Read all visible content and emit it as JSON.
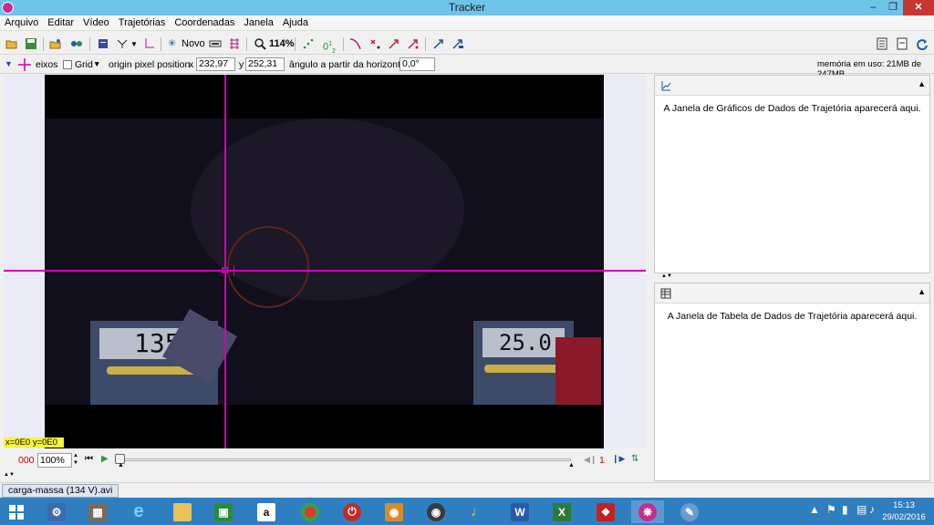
{
  "window": {
    "title": "Tracker"
  },
  "menu": [
    "Arquivo",
    "Editar",
    "Vídeo",
    "Trajetórias",
    "Coordenadas",
    "Janela",
    "Ajuda"
  ],
  "toolbar": {
    "new_label": "Novo",
    "zoom_label": "114%",
    "step_label": "0",
    "step_sub": "1",
    "step_sub2": "2"
  },
  "coords": {
    "axes_label": "eixos",
    "grid_label": "Grid",
    "origin_label": "origin pixel position",
    "x_label": "x",
    "x_value": "232,97",
    "y_label": "y",
    "y_value": "252,31",
    "angle_label": "ângulo a partir da horizontal",
    "angle_value": "0,0°",
    "memory_text": "memória em uso: 21MB de 247MB"
  },
  "video": {
    "readout": "x=0E0  y=0E0",
    "meter_left": "135",
    "meter_right": "25.0"
  },
  "player": {
    "frame_counter": "000",
    "rate_value": "100%",
    "step_value": "1"
  },
  "right": {
    "plot_message": "A Janela de Gráficos de Dados de Trajetória aparecerá aqui.",
    "table_message": "A Janela de Tabela de Dados de Trajetória aparecerá aqui."
  },
  "tab": {
    "label": "carga-massa (134 V).avi"
  },
  "taskbar": {
    "time": "15:13",
    "date": "29/02/2016",
    "amazon_glyph": "a",
    "word_glyph": "W",
    "excel_glyph": "X"
  },
  "colors": {
    "axis": "#d000b8",
    "titlebar": "#6ec3e8",
    "taskbar": "#2f7fc0",
    "readout_bg": "#f5f53a"
  }
}
